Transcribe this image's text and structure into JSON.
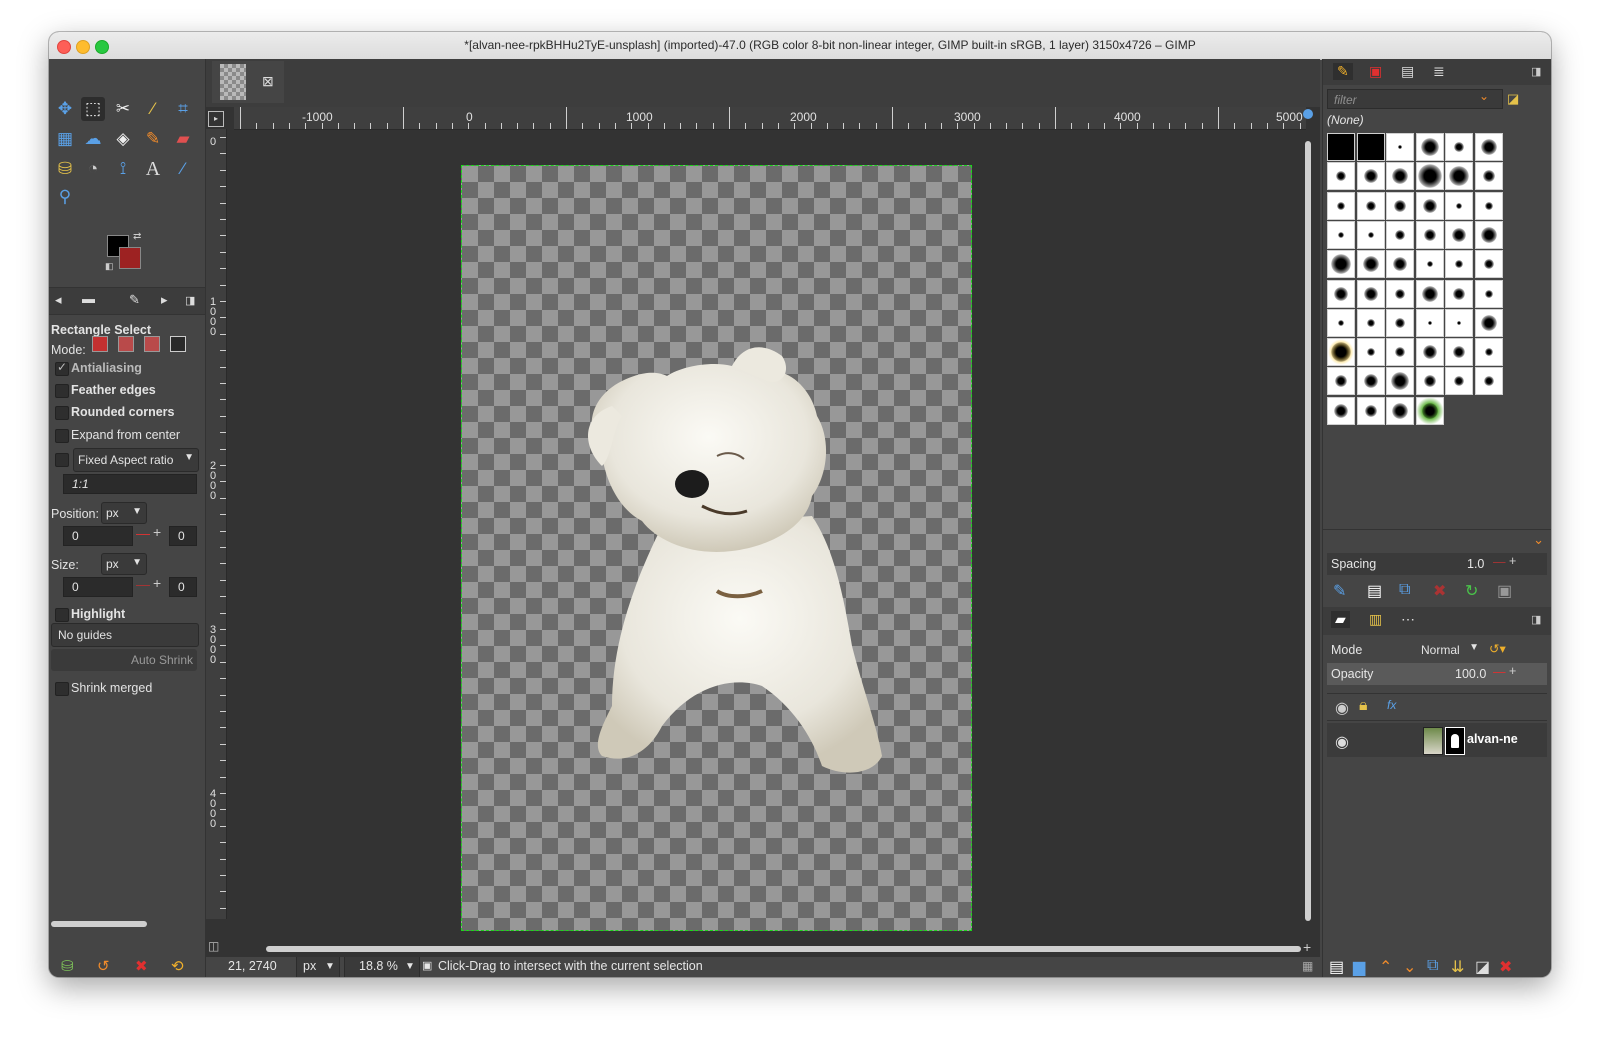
{
  "window": {
    "title": "*[alvan-nee-rpkBHHu2TyE-unsplash] (imported)-47.0 (RGB color 8-bit non-linear integer, GIMP built-in sRGB, 1 layer) 3150x4726 – GIMP"
  },
  "toolbox": {
    "tool_icons": [
      "move-tool-icon",
      "rect-select-tool-icon",
      "fuzzy-select-tool-icon",
      "magic-wand-icon",
      "crop-tool-icon",
      "warp-tool-icon",
      "smudge-tool-icon",
      "bucket-fill-icon",
      "pencil-icon",
      "eraser-icon",
      "clone-icon",
      "dodge-icon",
      "paths-icon",
      "text-icon",
      "color-picker-icon",
      "zoom-icon"
    ],
    "foreground_color": "#000000",
    "background_color": "#9d2222"
  },
  "tool_options": {
    "title": "Rectangle Select",
    "mode_label": "Mode:",
    "antialiasing": "Antialiasing",
    "feather_edges": "Feather edges",
    "rounded_corners": "Rounded corners",
    "expand_from_center": "Expand from center",
    "fixed_aspect": "Fixed Aspect ratio",
    "aspect_value": "1:1",
    "position_label": "Position:",
    "position_unit": "px",
    "position_x": "0",
    "position_y": "0",
    "size_label": "Size:",
    "size_unit": "px",
    "size_w": "0",
    "size_h": "0",
    "highlight": "Highlight",
    "guides": "No guides",
    "auto_shrink": "Auto Shrink",
    "shrink_merged": "Shrink merged"
  },
  "ruler": {
    "h_labels": [
      "-1000",
      "0",
      "1000",
      "2000",
      "3000",
      "4000",
      "5000"
    ],
    "v_labels": [
      "0",
      "1000",
      "2000",
      "3000",
      "4000"
    ]
  },
  "status": {
    "coords": "21, 2740",
    "unit": "px",
    "zoom": "18.8 %",
    "message": "Click-Drag to intersect with the current selection"
  },
  "brushes": {
    "filter_placeholder": "filter",
    "selected": "(None)",
    "spacing_label": "Spacing",
    "spacing_value": "1.0"
  },
  "layers": {
    "mode_label": "Mode",
    "mode_value": "Normal",
    "opacity_label": "Opacity",
    "opacity_value": "100.0",
    "layer_name": "alvan-ne"
  }
}
